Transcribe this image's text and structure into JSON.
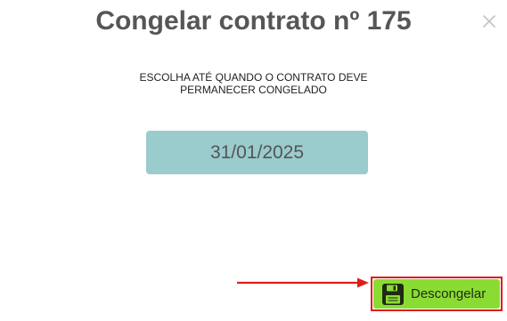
{
  "dialog": {
    "title": "Congelar contrato nº 175",
    "close_icon": "close-icon",
    "instruction_line1": "ESCOLHA ATÉ QUANDO O CONTRATO DEVE",
    "instruction_line2": "PERMANECER CONGELADO",
    "date_value": "31/01/2025",
    "unfreeze_button": {
      "label": "Descongelar",
      "icon": "floppy-disk-icon"
    },
    "colors": {
      "title": "#565656",
      "date_field_bg": "#9acbcd",
      "button_bg": "#8bdc32",
      "highlight": "#e11b1b"
    }
  }
}
